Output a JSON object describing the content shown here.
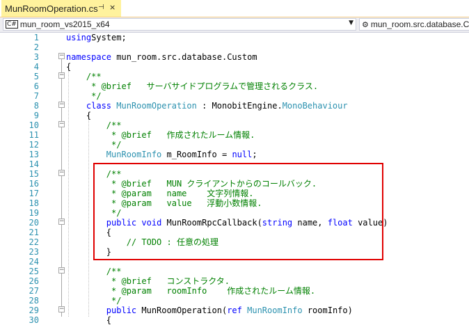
{
  "tab": {
    "title": "MunRoomOperation.cs",
    "pin_glyph": "⊣",
    "close_glyph": "×"
  },
  "navbar": {
    "project_combo": "mun_room_vs2015_x64",
    "type_combo": "mun_room.src.database.Cu"
  },
  "highlight_color": "#e00000",
  "lines": [
    {
      "n": "1",
      "fold": "",
      "segs": [
        [
          "kw",
          "using"
        ],
        [
          "",
          "System;"
        ]
      ]
    },
    {
      "n": "2",
      "fold": "",
      "segs": []
    },
    {
      "n": "3",
      "fold": "-",
      "segs": [
        [
          "kw",
          "namespace"
        ],
        [
          "",
          " mun_room.src.database.Custom"
        ]
      ]
    },
    {
      "n": "4",
      "fold": "",
      "segs": [
        [
          "",
          "{"
        ]
      ]
    },
    {
      "n": "5",
      "fold": "-",
      "segs": [
        [
          "cm",
          "    /**"
        ]
      ]
    },
    {
      "n": "6",
      "fold": "",
      "segs": [
        [
          "cm",
          "     * @brief   サーバサイドプログラムで管理されるクラス."
        ]
      ]
    },
    {
      "n": "7",
      "fold": "",
      "segs": [
        [
          "cm",
          "     */"
        ]
      ]
    },
    {
      "n": "8",
      "fold": "-",
      "segs": [
        [
          "",
          "    "
        ],
        [
          "kw",
          "class"
        ],
        [
          "",
          " "
        ],
        [
          "ty",
          "MunRoomOperation"
        ],
        [
          "",
          " : MonobitEngine."
        ],
        [
          "ty",
          "MonoBehaviour"
        ]
      ]
    },
    {
      "n": "9",
      "fold": "",
      "segs": [
        [
          "",
          "    {"
        ]
      ]
    },
    {
      "n": "10",
      "fold": "-",
      "segs": [
        [
          "cm",
          "        /**"
        ]
      ]
    },
    {
      "n": "11",
      "fold": "",
      "segs": [
        [
          "cm",
          "         * @brief   作成されたルーム情報."
        ]
      ]
    },
    {
      "n": "12",
      "fold": "",
      "segs": [
        [
          "cm",
          "         */"
        ]
      ]
    },
    {
      "n": "13",
      "fold": "",
      "segs": [
        [
          "",
          "        "
        ],
        [
          "ty",
          "MunRoomInfo"
        ],
        [
          "",
          " m_RoomInfo = "
        ],
        [
          "kw",
          "null"
        ],
        [
          "",
          ";"
        ]
      ]
    },
    {
      "n": "14",
      "fold": "",
      "segs": []
    },
    {
      "n": "15",
      "fold": "-",
      "segs": [
        [
          "cm",
          "        /**"
        ]
      ]
    },
    {
      "n": "16",
      "fold": "",
      "segs": [
        [
          "cm",
          "         * @brief   MUN クライアントからのコールバック."
        ]
      ]
    },
    {
      "n": "17",
      "fold": "",
      "segs": [
        [
          "cm",
          "         * @param   name    文字列情報."
        ]
      ]
    },
    {
      "n": "18",
      "fold": "",
      "segs": [
        [
          "cm",
          "         * @param   value   浮動小数情報."
        ]
      ]
    },
    {
      "n": "19",
      "fold": "",
      "segs": [
        [
          "cm",
          "         */"
        ]
      ]
    },
    {
      "n": "20",
      "fold": "-",
      "segs": [
        [
          "",
          "        "
        ],
        [
          "kw",
          "public"
        ],
        [
          "",
          " "
        ],
        [
          "kw",
          "void"
        ],
        [
          "",
          " MunRoomRpcCallback("
        ],
        [
          "kw",
          "string"
        ],
        [
          "",
          " name, "
        ],
        [
          "kw",
          "float"
        ],
        [
          "",
          " value)"
        ]
      ]
    },
    {
      "n": "21",
      "fold": "",
      "segs": [
        [
          "",
          "        {"
        ]
      ]
    },
    {
      "n": "22",
      "fold": "",
      "segs": [
        [
          "cm",
          "            // TODO : 任意の処理"
        ]
      ]
    },
    {
      "n": "23",
      "fold": "",
      "segs": [
        [
          "",
          "        }"
        ]
      ]
    },
    {
      "n": "24",
      "fold": "",
      "segs": []
    },
    {
      "n": "25",
      "fold": "-",
      "segs": [
        [
          "cm",
          "        /**"
        ]
      ]
    },
    {
      "n": "26",
      "fold": "",
      "segs": [
        [
          "cm",
          "         * @brief   コンストラクタ."
        ]
      ]
    },
    {
      "n": "27",
      "fold": "",
      "segs": [
        [
          "cm",
          "         * @param   roomInfo    作成されたルーム情報."
        ]
      ]
    },
    {
      "n": "28",
      "fold": "",
      "segs": [
        [
          "cm",
          "         */"
        ]
      ]
    },
    {
      "n": "29",
      "fold": "-",
      "segs": [
        [
          "",
          "        "
        ],
        [
          "kw",
          "public"
        ],
        [
          "",
          " MunRoomOperation("
        ],
        [
          "kw",
          "ref"
        ],
        [
          "",
          " "
        ],
        [
          "ty",
          "MunRoomInfo"
        ],
        [
          "",
          " roomInfo)"
        ]
      ]
    },
    {
      "n": "30",
      "fold": "",
      "segs": [
        [
          "",
          "        {"
        ]
      ]
    }
  ]
}
